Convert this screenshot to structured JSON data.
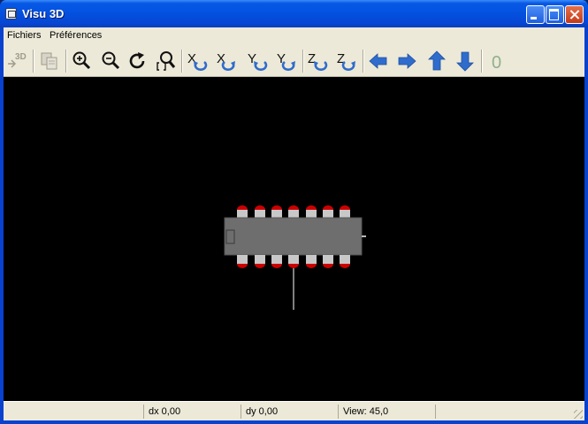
{
  "window": {
    "title": "Visu 3D"
  },
  "menu": {
    "items": [
      "Fichiers",
      "Préférences"
    ]
  },
  "toolbar": {
    "buttons": [
      {
        "name": "view-3d-button",
        "icon": "3d-view-icon",
        "label": "3D"
      },
      {
        "name": "copy-view-button",
        "icon": "copy-icon"
      },
      {
        "name": "zoom-in-button",
        "icon": "zoom-in-icon"
      },
      {
        "name": "zoom-out-button",
        "icon": "zoom-out-icon"
      },
      {
        "name": "redraw-button",
        "icon": "refresh-icon"
      },
      {
        "name": "zoom-fit-button",
        "icon": "zoom-fit-icon"
      },
      {
        "name": "rotate-x-neg-button",
        "icon": "rotate-x-icon",
        "label": "X"
      },
      {
        "name": "rotate-x-pos-button",
        "icon": "rotate-x-icon",
        "label": "X"
      },
      {
        "name": "rotate-y-neg-button",
        "icon": "rotate-y-icon",
        "label": "Y"
      },
      {
        "name": "rotate-y-pos-button",
        "icon": "rotate-y-icon",
        "label": "Y"
      },
      {
        "name": "rotate-z-neg-button",
        "icon": "rotate-z-icon",
        "label": "Z"
      },
      {
        "name": "rotate-z-pos-button",
        "icon": "rotate-z-icon",
        "label": "Z"
      },
      {
        "name": "pan-left-button",
        "icon": "arrow-left-icon"
      },
      {
        "name": "pan-right-button",
        "icon": "arrow-right-icon"
      },
      {
        "name": "pan-up-button",
        "icon": "arrow-up-icon"
      },
      {
        "name": "pan-down-button",
        "icon": "arrow-down-icon"
      },
      {
        "name": "reset-button",
        "icon": "zero-icon",
        "label": "0"
      }
    ]
  },
  "status": {
    "dx": "dx 0,00",
    "dy": "dy 0,00",
    "view": "View: 45,0"
  },
  "colors": {
    "viewport_background": "#000000",
    "chip_body": "#6e6e6e",
    "pin_tip": "#cc0000",
    "pin_metal": "#c8c8c8",
    "arrow_blue": "#2f6ccc"
  }
}
